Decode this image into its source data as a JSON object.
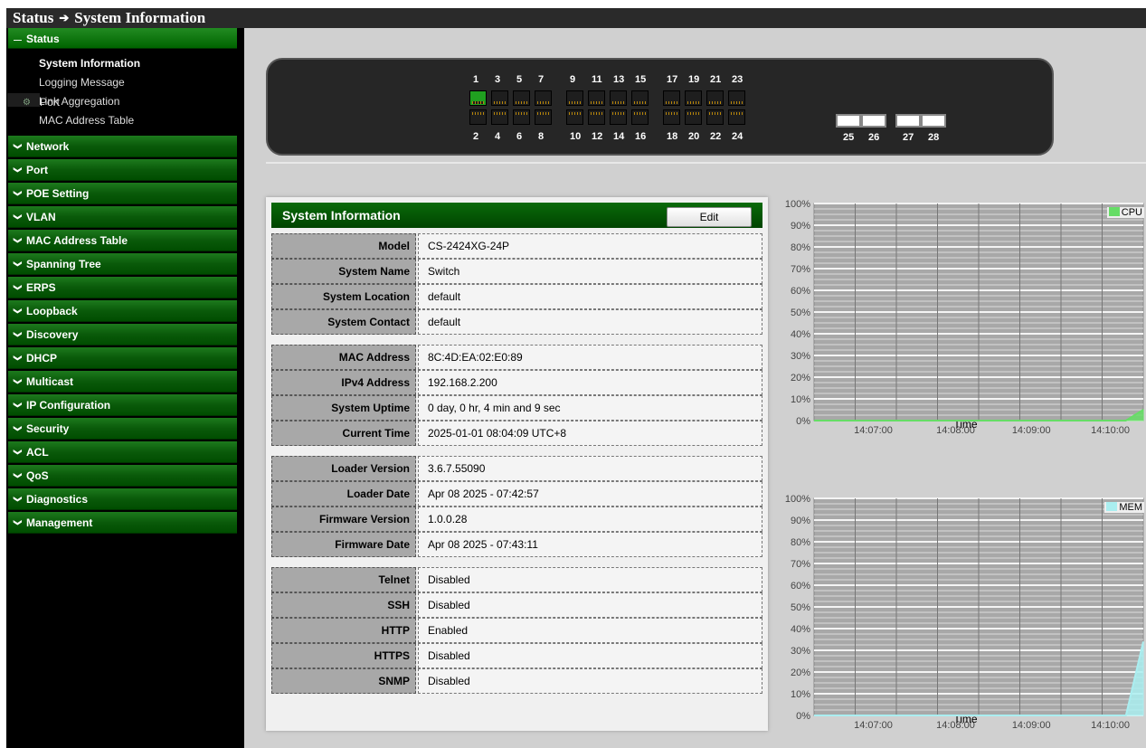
{
  "title": {
    "part1": "Status",
    "arrow": "➔",
    "part2": "System Information"
  },
  "sidebar": {
    "status_header": "Status",
    "status_items": [
      "System Information",
      "Logging Message",
      "Port",
      "Link Aggregation",
      "MAC Address Table"
    ],
    "menu": [
      "Network",
      "Port",
      "POE Setting",
      "VLAN",
      "MAC Address Table",
      "Spanning Tree",
      "ERPS",
      "Loopback",
      "Discovery",
      "DHCP",
      "Multicast",
      "IP Configuration",
      "Security",
      "ACL",
      "QoS",
      "Diagnostics",
      "Management"
    ]
  },
  "panel": {
    "top_numbers": [
      "1",
      "3",
      "5",
      "7",
      "9",
      "11",
      "13",
      "15",
      "17",
      "19",
      "21",
      "23"
    ],
    "bottom_numbers": [
      "2",
      "4",
      "6",
      "8",
      "10",
      "12",
      "14",
      "16",
      "18",
      "20",
      "22",
      "24"
    ],
    "sfp_numbers": [
      "25",
      "26",
      "27",
      "28"
    ],
    "active_port": "1"
  },
  "info": {
    "title": "System Information",
    "edit_label": "Edit",
    "groups": [
      [
        {
          "label": "Model",
          "value": "CS-2424XG-24P"
        },
        {
          "label": "System Name",
          "value": "Switch"
        },
        {
          "label": "System Location",
          "value": "default"
        },
        {
          "label": "System Contact",
          "value": "default"
        }
      ],
      [
        {
          "label": "MAC Address",
          "value": "8C:4D:EA:02:E0:89"
        },
        {
          "label": "IPv4 Address",
          "value": "192.168.2.200"
        },
        {
          "label": "System Uptime",
          "value": "0 day, 0 hr, 4 min and 9 sec"
        },
        {
          "label": "Current Time",
          "value": "2025-01-01 08:04:09 UTC+8"
        }
      ],
      [
        {
          "label": "Loader Version",
          "value": "3.6.7.55090"
        },
        {
          "label": "Loader Date",
          "value": "Apr 08 2025 - 07:42:57"
        },
        {
          "label": "Firmware Version",
          "value": "1.0.0.28"
        },
        {
          "label": "Firmware Date",
          "value": "Apr 08 2025 - 07:43:11"
        }
      ],
      [
        {
          "label": "Telnet",
          "value": "Disabled"
        },
        {
          "label": "SSH",
          "value": "Disabled"
        },
        {
          "label": "HTTP",
          "value": "Enabled"
        },
        {
          "label": "HTTPS",
          "value": "Disabled"
        },
        {
          "label": "SNMP",
          "value": "Disabled"
        }
      ]
    ]
  },
  "chart_data": [
    {
      "type": "area",
      "series": [
        {
          "name": "CPU",
          "color": "#66dd66",
          "values": [
            0,
            0,
            0,
            0,
            0,
            0,
            0,
            0,
            0,
            0,
            0,
            0,
            0,
            0,
            0,
            0,
            0,
            0,
            0,
            5
          ]
        }
      ],
      "y_ticks": [
        "0%",
        "10%",
        "20%",
        "30%",
        "40%",
        "50%",
        "60%",
        "70%",
        "80%",
        "90%",
        "100%"
      ],
      "x_ticks": [
        "14:07:00",
        "14:08:00",
        "14:09:00",
        "14:10:00"
      ],
      "xlabel": "Time",
      "ylim": [
        0,
        100
      ]
    },
    {
      "type": "area",
      "series": [
        {
          "name": "MEM",
          "color": "#aaeef0",
          "values": [
            0,
            0,
            0,
            0,
            0,
            0,
            0,
            0,
            0,
            0,
            0,
            0,
            0,
            0,
            0,
            0,
            0,
            0,
            0,
            34
          ]
        }
      ],
      "y_ticks": [
        "0%",
        "10%",
        "20%",
        "30%",
        "40%",
        "50%",
        "60%",
        "70%",
        "80%",
        "90%",
        "100%"
      ],
      "x_ticks": [
        "14:07:00",
        "14:08:00",
        "14:09:00",
        "14:10:00"
      ],
      "xlabel": "Time",
      "ylim": [
        0,
        100
      ]
    }
  ]
}
